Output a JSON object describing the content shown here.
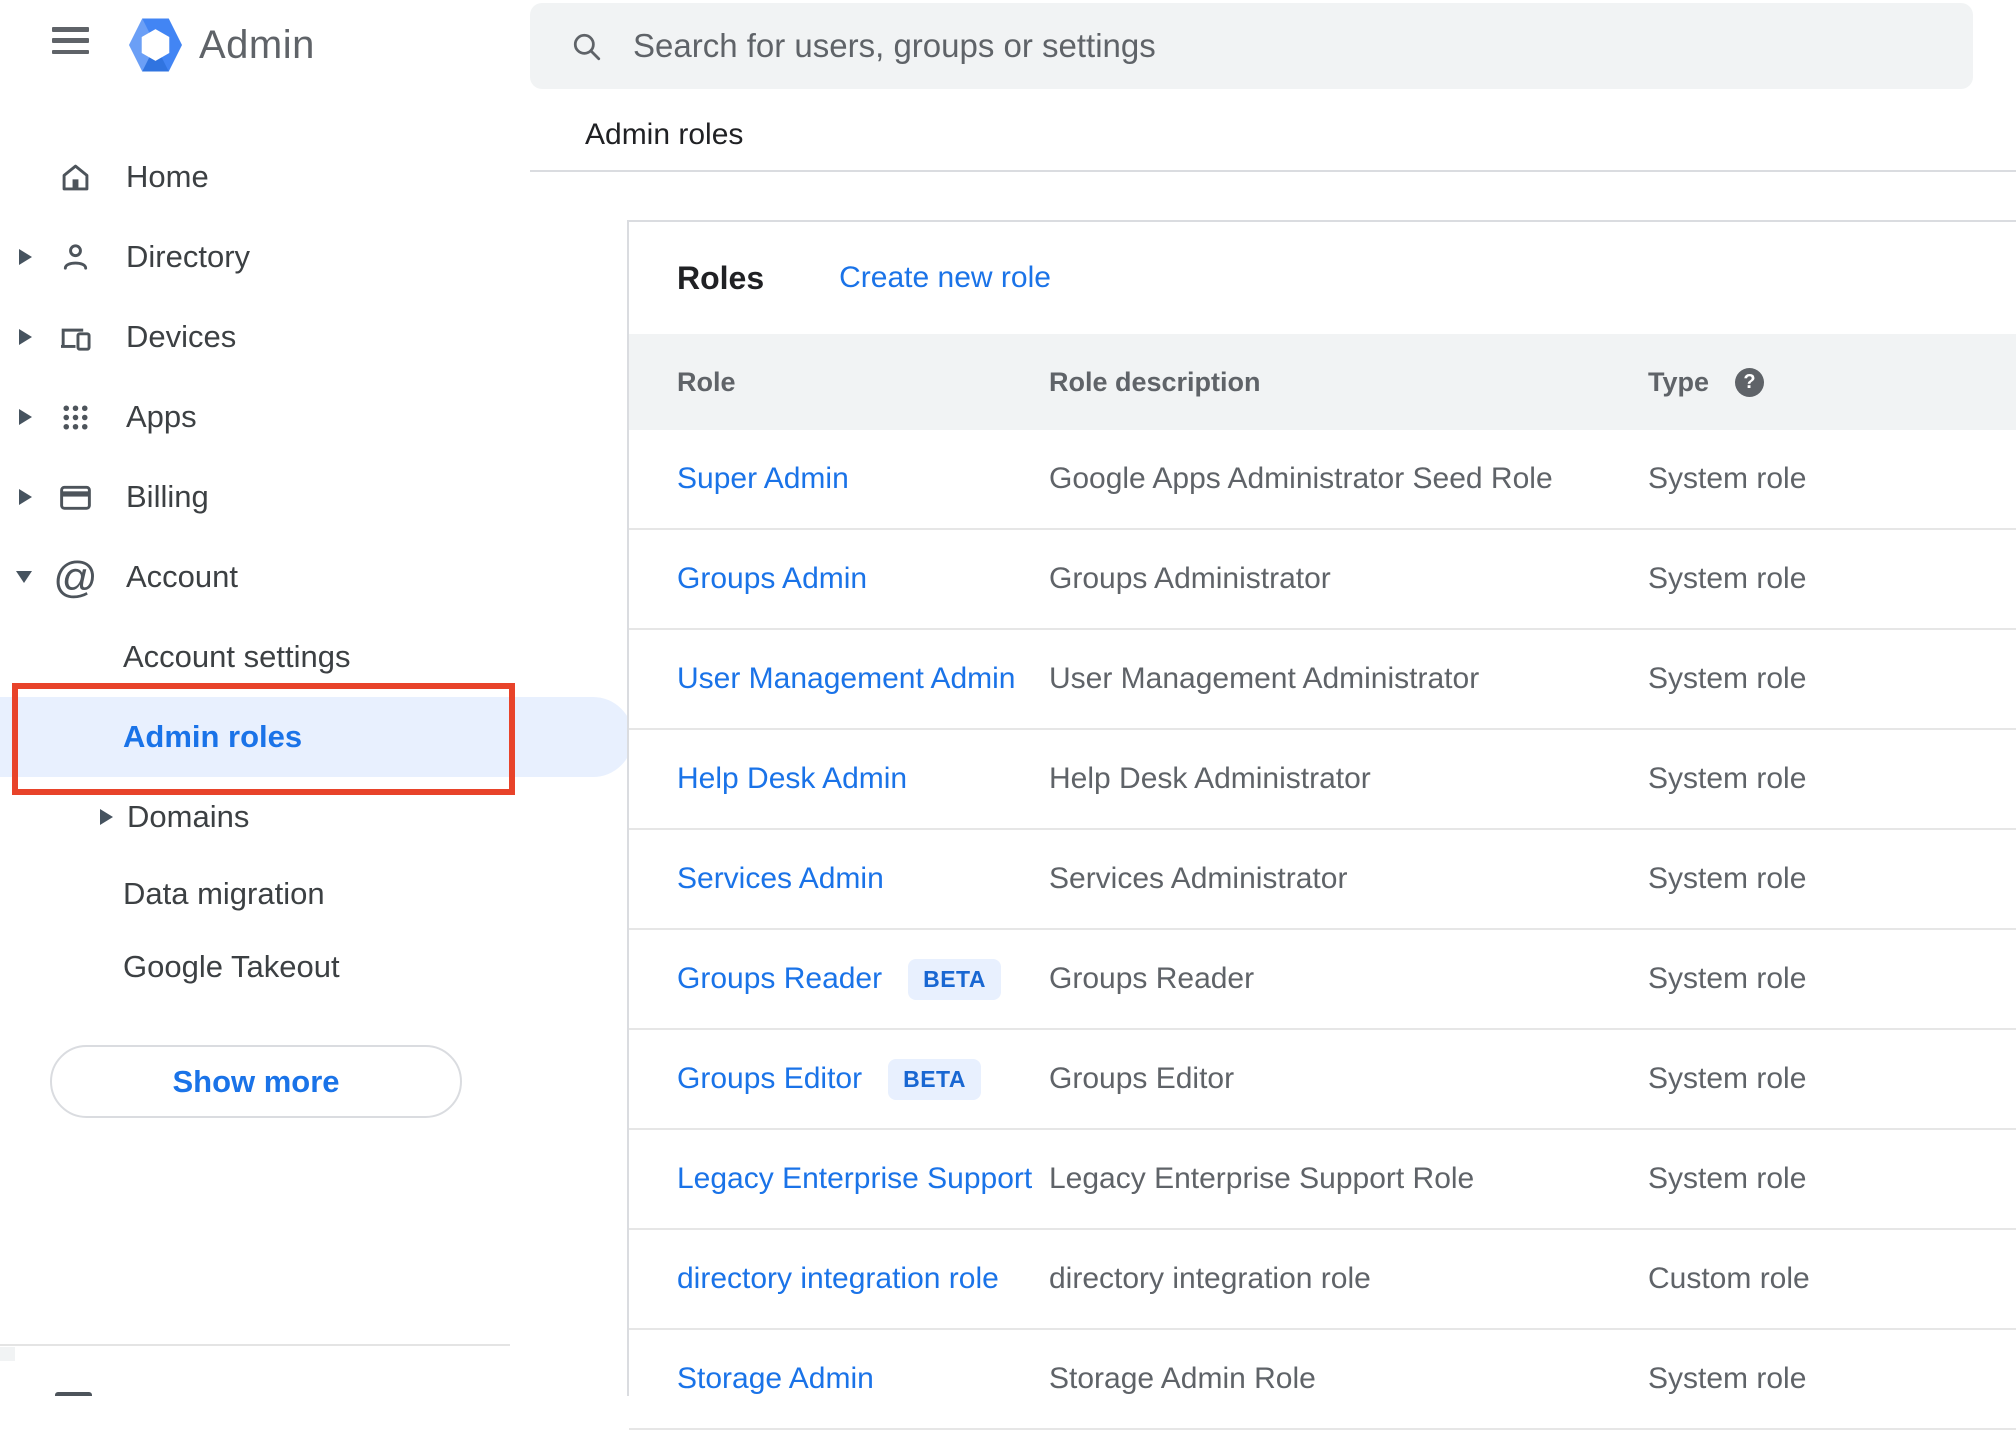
{
  "sidebar": {
    "logo_text": "Admin",
    "items": [
      {
        "label": "Home",
        "icon": "home-icon",
        "arrow": "none"
      },
      {
        "label": "Directory",
        "icon": "directory-icon",
        "arrow": "right"
      },
      {
        "label": "Devices",
        "icon": "devices-icon",
        "arrow": "right"
      },
      {
        "label": "Apps",
        "icon": "apps-icon",
        "arrow": "right"
      },
      {
        "label": "Billing",
        "icon": "billing-icon",
        "arrow": "right"
      },
      {
        "label": "Account",
        "icon": "account-icon",
        "arrow": "down"
      }
    ],
    "sub_items": [
      {
        "label": "Account settings",
        "selected": false,
        "arrow": "none"
      },
      {
        "label": "Admin roles",
        "selected": true,
        "arrow": "none"
      },
      {
        "label": "Domains",
        "selected": false,
        "arrow": "right"
      },
      {
        "label": "Data migration",
        "selected": false,
        "arrow": "none"
      },
      {
        "label": "Google Takeout",
        "selected": false,
        "arrow": "none"
      }
    ],
    "show_more_label": "Show more"
  },
  "search": {
    "placeholder": "Search for users, groups or settings"
  },
  "breadcrumb": "Admin roles",
  "roles_card": {
    "title": "Roles",
    "create_link": "Create new role",
    "columns": [
      "Role",
      "Role description",
      "Type"
    ],
    "beta_label": "BETA",
    "rows": [
      {
        "role": "Super Admin",
        "beta": false,
        "description": "Google Apps Administrator Seed Role",
        "type": "System role"
      },
      {
        "role": "Groups Admin",
        "beta": false,
        "description": "Groups Administrator",
        "type": "System role"
      },
      {
        "role": "User Management Admin",
        "beta": false,
        "description": "User Management Administrator",
        "type": "System role"
      },
      {
        "role": "Help Desk Admin",
        "beta": false,
        "description": "Help Desk Administrator",
        "type": "System role"
      },
      {
        "role": "Services Admin",
        "beta": false,
        "description": "Services Administrator",
        "type": "System role"
      },
      {
        "role": "Groups Reader",
        "beta": true,
        "description": "Groups Reader",
        "type": "System role"
      },
      {
        "role": "Groups Editor",
        "beta": true,
        "description": "Groups Editor",
        "type": "System role"
      },
      {
        "role": "Legacy Enterprise Support",
        "beta": false,
        "description": "Legacy Enterprise Support Role",
        "type": "System role"
      },
      {
        "role": "directory integration role",
        "beta": false,
        "description": "directory integration role",
        "type": "Custom role"
      },
      {
        "role": "Storage Admin",
        "beta": false,
        "description": "Storage Admin Role",
        "type": "System role"
      }
    ]
  },
  "colors": {
    "link_blue": "#1a73e8",
    "selected_item_bg": "#e8f0fe",
    "annotation_red": "#e8432a",
    "table_header_bg": "#f1f3f4",
    "search_bar_bg": "#f1f3f4",
    "beta_badge_bg": "#e8f0fe",
    "beta_badge_text": "#1967d2",
    "logo_blue": "#4285f4"
  }
}
